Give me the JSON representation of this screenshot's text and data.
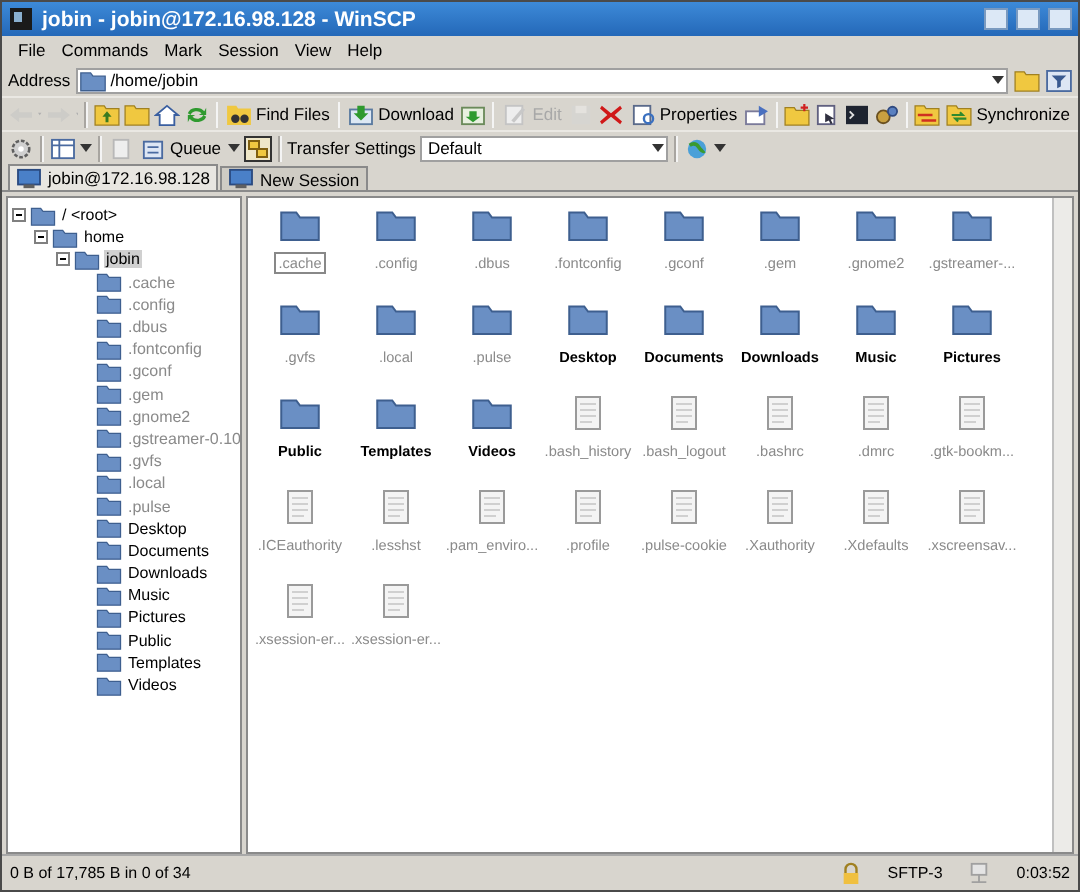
{
  "window": {
    "title": "jobin - jobin@172.16.98.128 - WinSCP"
  },
  "menu": [
    "File",
    "Commands",
    "Mark",
    "Session",
    "View",
    "Help"
  ],
  "address": {
    "label": "Address",
    "value": "/home/jobin"
  },
  "toolbar": [
    {
      "kind": "icon",
      "disabled": true
    },
    {
      "kind": "dropdown",
      "disabled": true
    },
    {
      "kind": "icon",
      "disabled": true
    },
    {
      "kind": "dropdown",
      "disabled": true
    },
    {
      "kind": "separator"
    },
    {
      "kind": "icon",
      "disabled": false
    },
    {
      "kind": "icon",
      "disabled": false
    },
    {
      "kind": "icon",
      "disabled": false
    },
    {
      "kind": "icon",
      "disabled": false
    },
    {
      "kind": "separator"
    },
    {
      "kind": "button",
      "label": "Find Files",
      "disabled": false
    },
    {
      "kind": "separator"
    },
    {
      "kind": "button",
      "label": "Download",
      "disabled": false
    },
    {
      "kind": "icon",
      "disabled": false
    },
    {
      "kind": "separator"
    },
    {
      "kind": "button",
      "label": "Edit",
      "disabled": true
    },
    {
      "kind": "icon",
      "disabled": true
    },
    {
      "kind": "icon",
      "disabled": false
    },
    {
      "kind": "button",
      "label": "Properties",
      "disabled": false
    },
    {
      "kind": "icon",
      "disabled": false
    },
    {
      "kind": "separator"
    },
    {
      "kind": "icon",
      "disabled": false
    },
    {
      "kind": "icon",
      "disabled": false
    },
    {
      "kind": "icon",
      "disabled": false
    },
    {
      "kind": "icon",
      "disabled": false
    },
    {
      "kind": "separator"
    },
    {
      "kind": "icon",
      "disabled": false
    },
    {
      "kind": "button",
      "label": "Synchronize",
      "disabled": false
    }
  ],
  "toolbar2": {
    "queue_label": "Queue",
    "queue_panel_on": true,
    "transfer_label": "Transfer Settings",
    "transfer_value": "Default"
  },
  "tabs": [
    {
      "label": "jobin@172.16.98.128",
      "selected": true
    },
    {
      "label": "New Session",
      "selected": false
    }
  ],
  "tree": [
    {
      "name": "/ <root>",
      "expanded": true,
      "selected": false,
      "hidden": false,
      "children": [
        {
          "name": "home",
          "expanded": true,
          "selected": false,
          "hidden": false,
          "children": [
            {
              "name": "jobin",
              "expanded": true,
              "selected": true,
              "hidden": false,
              "children": [
                {
                  "name": ".cache",
                  "hidden": true,
                  "selected": false
                },
                {
                  "name": ".config",
                  "hidden": true,
                  "selected": false
                },
                {
                  "name": ".dbus",
                  "hidden": true,
                  "selected": false
                },
                {
                  "name": ".fontconfig",
                  "hidden": true,
                  "selected": false
                },
                {
                  "name": ".gconf",
                  "hidden": true,
                  "selected": false
                },
                {
                  "name": ".gem",
                  "hidden": true,
                  "selected": false
                },
                {
                  "name": ".gnome2",
                  "hidden": true,
                  "selected": false
                },
                {
                  "name": ".gstreamer-0.10",
                  "hidden": true,
                  "selected": false
                },
                {
                  "name": ".gvfs",
                  "hidden": true,
                  "selected": false
                },
                {
                  "name": ".local",
                  "hidden": true,
                  "selected": false
                },
                {
                  "name": ".pulse",
                  "hidden": true,
                  "selected": false
                },
                {
                  "name": "Desktop",
                  "hidden": false,
                  "selected": false
                },
                {
                  "name": "Documents",
                  "hidden": false,
                  "selected": false
                },
                {
                  "name": "Downloads",
                  "hidden": false,
                  "selected": false
                },
                {
                  "name": "Music",
                  "hidden": false,
                  "selected": false
                },
                {
                  "name": "Pictures",
                  "hidden": false,
                  "selected": false
                },
                {
                  "name": "Public",
                  "hidden": false,
                  "selected": false
                },
                {
                  "name": "Templates",
                  "hidden": false,
                  "selected": false
                },
                {
                  "name": "Videos",
                  "hidden": false,
                  "selected": false
                }
              ]
            }
          ]
        }
      ]
    }
  ],
  "files": [
    {
      "name": ".cache",
      "kind": "folder",
      "hidden": true,
      "selected": true
    },
    {
      "name": ".config",
      "kind": "folder",
      "hidden": true,
      "selected": false
    },
    {
      "name": ".dbus",
      "kind": "folder",
      "hidden": true,
      "selected": false
    },
    {
      "name": ".fontconfig",
      "kind": "folder",
      "hidden": true,
      "selected": false
    },
    {
      "name": ".gconf",
      "kind": "folder",
      "hidden": true,
      "selected": false
    },
    {
      "name": ".gem",
      "kind": "folder",
      "hidden": true,
      "selected": false
    },
    {
      "name": ".gnome2",
      "kind": "folder",
      "hidden": true,
      "selected": false
    },
    {
      "name": ".gstreamer-...",
      "kind": "folder",
      "hidden": true,
      "selected": false
    },
    {
      "name": ".gvfs",
      "kind": "folder",
      "hidden": true,
      "selected": false
    },
    {
      "name": ".local",
      "kind": "folder",
      "hidden": true,
      "selected": false
    },
    {
      "name": ".pulse",
      "kind": "folder",
      "hidden": true,
      "selected": false
    },
    {
      "name": "Desktop",
      "kind": "folder",
      "hidden": false,
      "selected": false
    },
    {
      "name": "Documents",
      "kind": "folder",
      "hidden": false,
      "selected": false
    },
    {
      "name": "Downloads",
      "kind": "folder",
      "hidden": false,
      "selected": false
    },
    {
      "name": "Music",
      "kind": "folder",
      "hidden": false,
      "selected": false
    },
    {
      "name": "Pictures",
      "kind": "folder",
      "hidden": false,
      "selected": false
    },
    {
      "name": "Public",
      "kind": "folder",
      "hidden": false,
      "selected": false
    },
    {
      "name": "Templates",
      "kind": "folder",
      "hidden": false,
      "selected": false
    },
    {
      "name": "Videos",
      "kind": "folder",
      "hidden": false,
      "selected": false
    },
    {
      "name": ".bash_history",
      "kind": "file",
      "hidden": true,
      "selected": false
    },
    {
      "name": ".bash_logout",
      "kind": "file",
      "hidden": true,
      "selected": false
    },
    {
      "name": ".bashrc",
      "kind": "file",
      "hidden": true,
      "selected": false
    },
    {
      "name": ".dmrc",
      "kind": "file",
      "hidden": true,
      "selected": false
    },
    {
      "name": ".gtk-bookm...",
      "kind": "file",
      "hidden": true,
      "selected": false
    },
    {
      "name": ".ICEauthority",
      "kind": "file",
      "hidden": true,
      "selected": false
    },
    {
      "name": ".lesshst",
      "kind": "file",
      "hidden": true,
      "selected": false
    },
    {
      "name": ".pam_enviro...",
      "kind": "file",
      "hidden": true,
      "selected": false
    },
    {
      "name": ".profile",
      "kind": "file",
      "hidden": true,
      "selected": false
    },
    {
      "name": ".pulse-cookie",
      "kind": "file",
      "hidden": true,
      "selected": false
    },
    {
      "name": ".Xauthority",
      "kind": "file",
      "hidden": true,
      "selected": false
    },
    {
      "name": ".Xdefaults",
      "kind": "file",
      "hidden": true,
      "selected": false
    },
    {
      "name": ".xscreensav...",
      "kind": "file",
      "hidden": true,
      "selected": false
    },
    {
      "name": ".xsession-er...",
      "kind": "file",
      "hidden": true,
      "selected": false
    },
    {
      "name": ".xsession-er...",
      "kind": "file",
      "hidden": true,
      "selected": false
    }
  ],
  "status_bar": {
    "selection": "0 B of 17,785 B in 0 of 34",
    "protocol": "SFTP-3",
    "elapsed": "0:03:52"
  }
}
